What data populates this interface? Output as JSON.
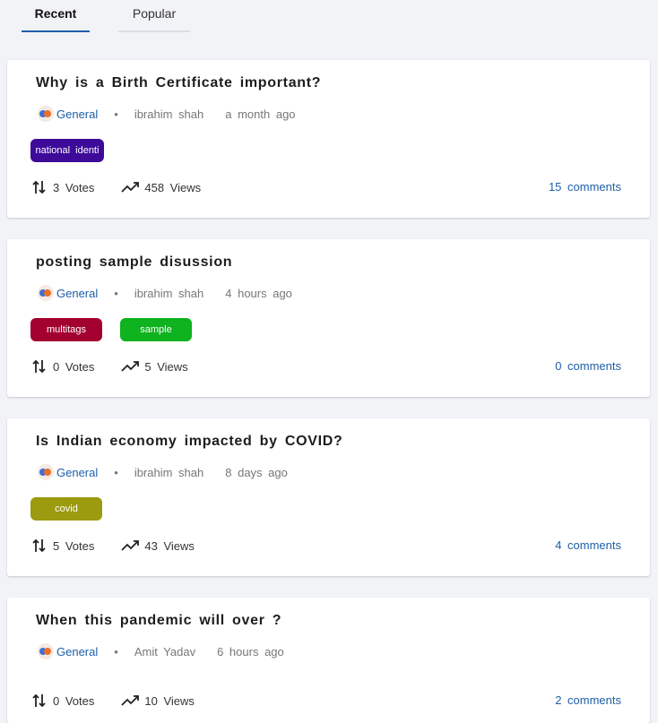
{
  "tabs": [
    {
      "label": "Recent",
      "active": true
    },
    {
      "label": "Popular",
      "active": false
    }
  ],
  "icons": {
    "category": "category-icon",
    "votes": "vote-arrows-icon",
    "views": "trending-up-icon"
  },
  "colors": {
    "accent": "#1e5fa8",
    "background": "#f2f3f7"
  },
  "posts": [
    {
      "title": "Why is a Birth Certificate important?",
      "category": "General",
      "author": "ibrahim shah",
      "time": "a month ago",
      "tags": [
        {
          "label": "national identi",
          "color": "#3d0a99"
        }
      ],
      "votes": "3 Votes",
      "views": "458 Views",
      "comments": "15 comments"
    },
    {
      "title": "posting sample disussion",
      "category": "General",
      "author": "ibrahim shah",
      "time": "4 hours ago",
      "tags": [
        {
          "label": "multitags",
          "color": "#a3002f"
        },
        {
          "label": "sample",
          "color": "#0fb21f"
        }
      ],
      "votes": "0 Votes",
      "views": "5 Views",
      "comments": "0 comments"
    },
    {
      "title": "Is Indian economy impacted by COVID?",
      "category": "General",
      "author": "ibrahim shah",
      "time": "8 days ago",
      "tags": [
        {
          "label": "covid",
          "color": "#9c9a0e"
        }
      ],
      "votes": "5 Votes",
      "views": "43 Views",
      "comments": "4 comments"
    },
    {
      "title": "When this pandemic will over ?",
      "category": "General",
      "author": "Amit Yadav",
      "time": "6 hours ago",
      "tags": [],
      "votes": "0 Votes",
      "views": "10 Views",
      "comments": "2 comments"
    }
  ]
}
